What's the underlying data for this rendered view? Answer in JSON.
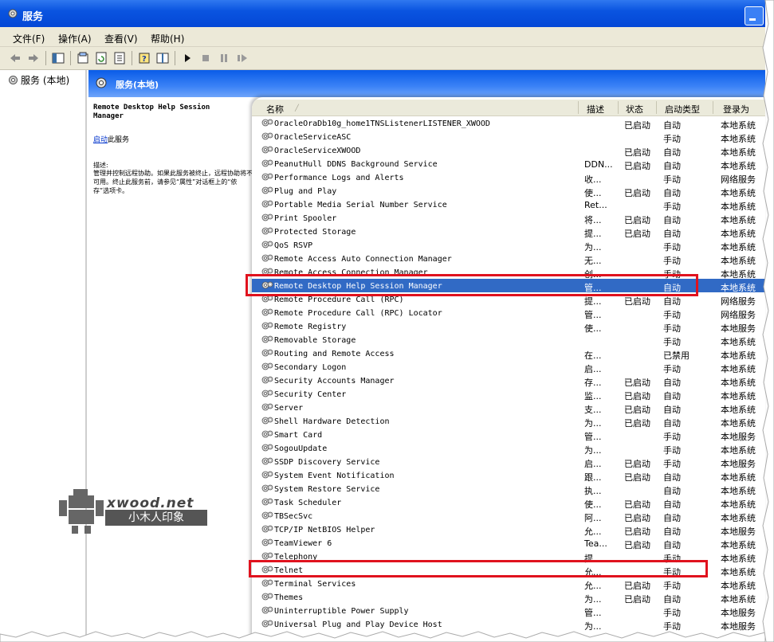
{
  "window": {
    "title": "服务"
  },
  "menu": [
    "文件(F)",
    "操作(A)",
    "查看(V)",
    "帮助(H)"
  ],
  "tree": {
    "root_label": "服务 (本地)"
  },
  "pane": {
    "header": "服务(本地)"
  },
  "desc": {
    "title": "Remote Desktop Help Session Manager",
    "start_link": "启动",
    "start_suffix": "此服务",
    "label": "描述:",
    "body": "管理并控制远程协助。如果此服务被终止，远程协助将不可用。终止此服务前，请参见“属性”对话框上的“依存”选项卡。"
  },
  "columns": {
    "name": "名称",
    "desc": "描述",
    "status": "状态",
    "start": "启动类型",
    "logon": "登录为"
  },
  "rows": [
    {
      "name": "OracleOraDb10g_home1TNSListenerLISTENER_XWOOD",
      "desc": "",
      "status": "已启动",
      "start": "自动",
      "logon": "本地系统"
    },
    {
      "name": "OracleServiceASC",
      "desc": "",
      "status": "",
      "start": "手动",
      "logon": "本地系统"
    },
    {
      "name": "OracleServiceXWOOD",
      "desc": "",
      "status": "已启动",
      "start": "自动",
      "logon": "本地系统"
    },
    {
      "name": "PeanutHull DDNS Background Service",
      "desc": "DDN...",
      "status": "已启动",
      "start": "自动",
      "logon": "本地系统"
    },
    {
      "name": "Performance Logs and Alerts",
      "desc": "收...",
      "status": "",
      "start": "手动",
      "logon": "网络服务"
    },
    {
      "name": "Plug and Play",
      "desc": "使...",
      "status": "已启动",
      "start": "自动",
      "logon": "本地系统"
    },
    {
      "name": "Portable Media Serial Number Service",
      "desc": "Ret...",
      "status": "",
      "start": "手动",
      "logon": "本地系统"
    },
    {
      "name": "Print Spooler",
      "desc": "将...",
      "status": "已启动",
      "start": "自动",
      "logon": "本地系统"
    },
    {
      "name": "Protected Storage",
      "desc": "提...",
      "status": "已启动",
      "start": "自动",
      "logon": "本地系统"
    },
    {
      "name": "QoS RSVP",
      "desc": "为...",
      "status": "",
      "start": "手动",
      "logon": "本地系统"
    },
    {
      "name": "Remote Access Auto Connection Manager",
      "desc": "无...",
      "status": "",
      "start": "手动",
      "logon": "本地系统"
    },
    {
      "name": "Remote Access Connection Manager",
      "desc": "创...",
      "status": "",
      "start": "手动",
      "logon": "本地系统"
    },
    {
      "name": "Remote Desktop Help Session Manager",
      "desc": "管...",
      "status": "",
      "start": "自动",
      "logon": "本地系统"
    },
    {
      "name": "Remote Procedure Call (RPC)",
      "desc": "提...",
      "status": "已启动",
      "start": "自动",
      "logon": "网络服务"
    },
    {
      "name": "Remote Procedure Call (RPC) Locator",
      "desc": "管...",
      "status": "",
      "start": "手动",
      "logon": "网络服务"
    },
    {
      "name": "Remote Registry",
      "desc": "使...",
      "status": "",
      "start": "手动",
      "logon": "本地服务"
    },
    {
      "name": "Removable Storage",
      "desc": "",
      "status": "",
      "start": "手动",
      "logon": "本地系统"
    },
    {
      "name": "Routing and Remote Access",
      "desc": "在...",
      "status": "",
      "start": "已禁用",
      "logon": "本地系统"
    },
    {
      "name": "Secondary Logon",
      "desc": "启...",
      "status": "",
      "start": "手动",
      "logon": "本地系统"
    },
    {
      "name": "Security Accounts Manager",
      "desc": "存...",
      "status": "已启动",
      "start": "自动",
      "logon": "本地系统"
    },
    {
      "name": "Security Center",
      "desc": "监...",
      "status": "已启动",
      "start": "自动",
      "logon": "本地系统"
    },
    {
      "name": "Server",
      "desc": "支...",
      "status": "已启动",
      "start": "自动",
      "logon": "本地系统"
    },
    {
      "name": "Shell Hardware Detection",
      "desc": "为...",
      "status": "已启动",
      "start": "自动",
      "logon": "本地系统"
    },
    {
      "name": "Smart Card",
      "desc": "管...",
      "status": "",
      "start": "手动",
      "logon": "本地服务"
    },
    {
      "name": "SogouUpdate",
      "desc": "为...",
      "status": "",
      "start": "手动",
      "logon": "本地系统"
    },
    {
      "name": "SSDP Discovery Service",
      "desc": "启...",
      "status": "已启动",
      "start": "手动",
      "logon": "本地服务"
    },
    {
      "name": "System Event Notification",
      "desc": "跟...",
      "status": "已启动",
      "start": "自动",
      "logon": "本地系统"
    },
    {
      "name": "System Restore Service",
      "desc": "执...",
      "status": "",
      "start": "自动",
      "logon": "本地系统"
    },
    {
      "name": "Task Scheduler",
      "desc": "使...",
      "status": "已启动",
      "start": "自动",
      "logon": "本地系统"
    },
    {
      "name": "TBSecSvc",
      "desc": "阿...",
      "status": "已启动",
      "start": "自动",
      "logon": "本地系统"
    },
    {
      "name": "TCP/IP NetBIOS Helper",
      "desc": "允...",
      "status": "已启动",
      "start": "自动",
      "logon": "本地服务"
    },
    {
      "name": "TeamViewer 6",
      "desc": "Tea...",
      "status": "已启动",
      "start": "自动",
      "logon": "本地系统"
    },
    {
      "name": "Telephony",
      "desc": "提...",
      "status": "",
      "start": "手动",
      "logon": "本地系统"
    },
    {
      "name": "Telnet",
      "desc": "允...",
      "status": "",
      "start": "手动",
      "logon": "本地系统"
    },
    {
      "name": "Terminal Services",
      "desc": "允...",
      "status": "已启动",
      "start": "手动",
      "logon": "本地系统"
    },
    {
      "name": "Themes",
      "desc": "为...",
      "status": "已启动",
      "start": "自动",
      "logon": "本地系统"
    },
    {
      "name": "Uninterruptible Power Supply",
      "desc": "管...",
      "status": "",
      "start": "手动",
      "logon": "本地服务"
    },
    {
      "name": "Universal Plug and Play Device Host",
      "desc": "为...",
      "status": "",
      "start": "手动",
      "logon": "本地服务"
    }
  ],
  "selected_row": 12,
  "watermark": {
    "brand": "xwood.net",
    "tagline": "小木人印象"
  },
  "colors": {
    "selection": "#316ac5",
    "highlight_box": "#e0121e",
    "titlebar": "#0a54e0"
  }
}
